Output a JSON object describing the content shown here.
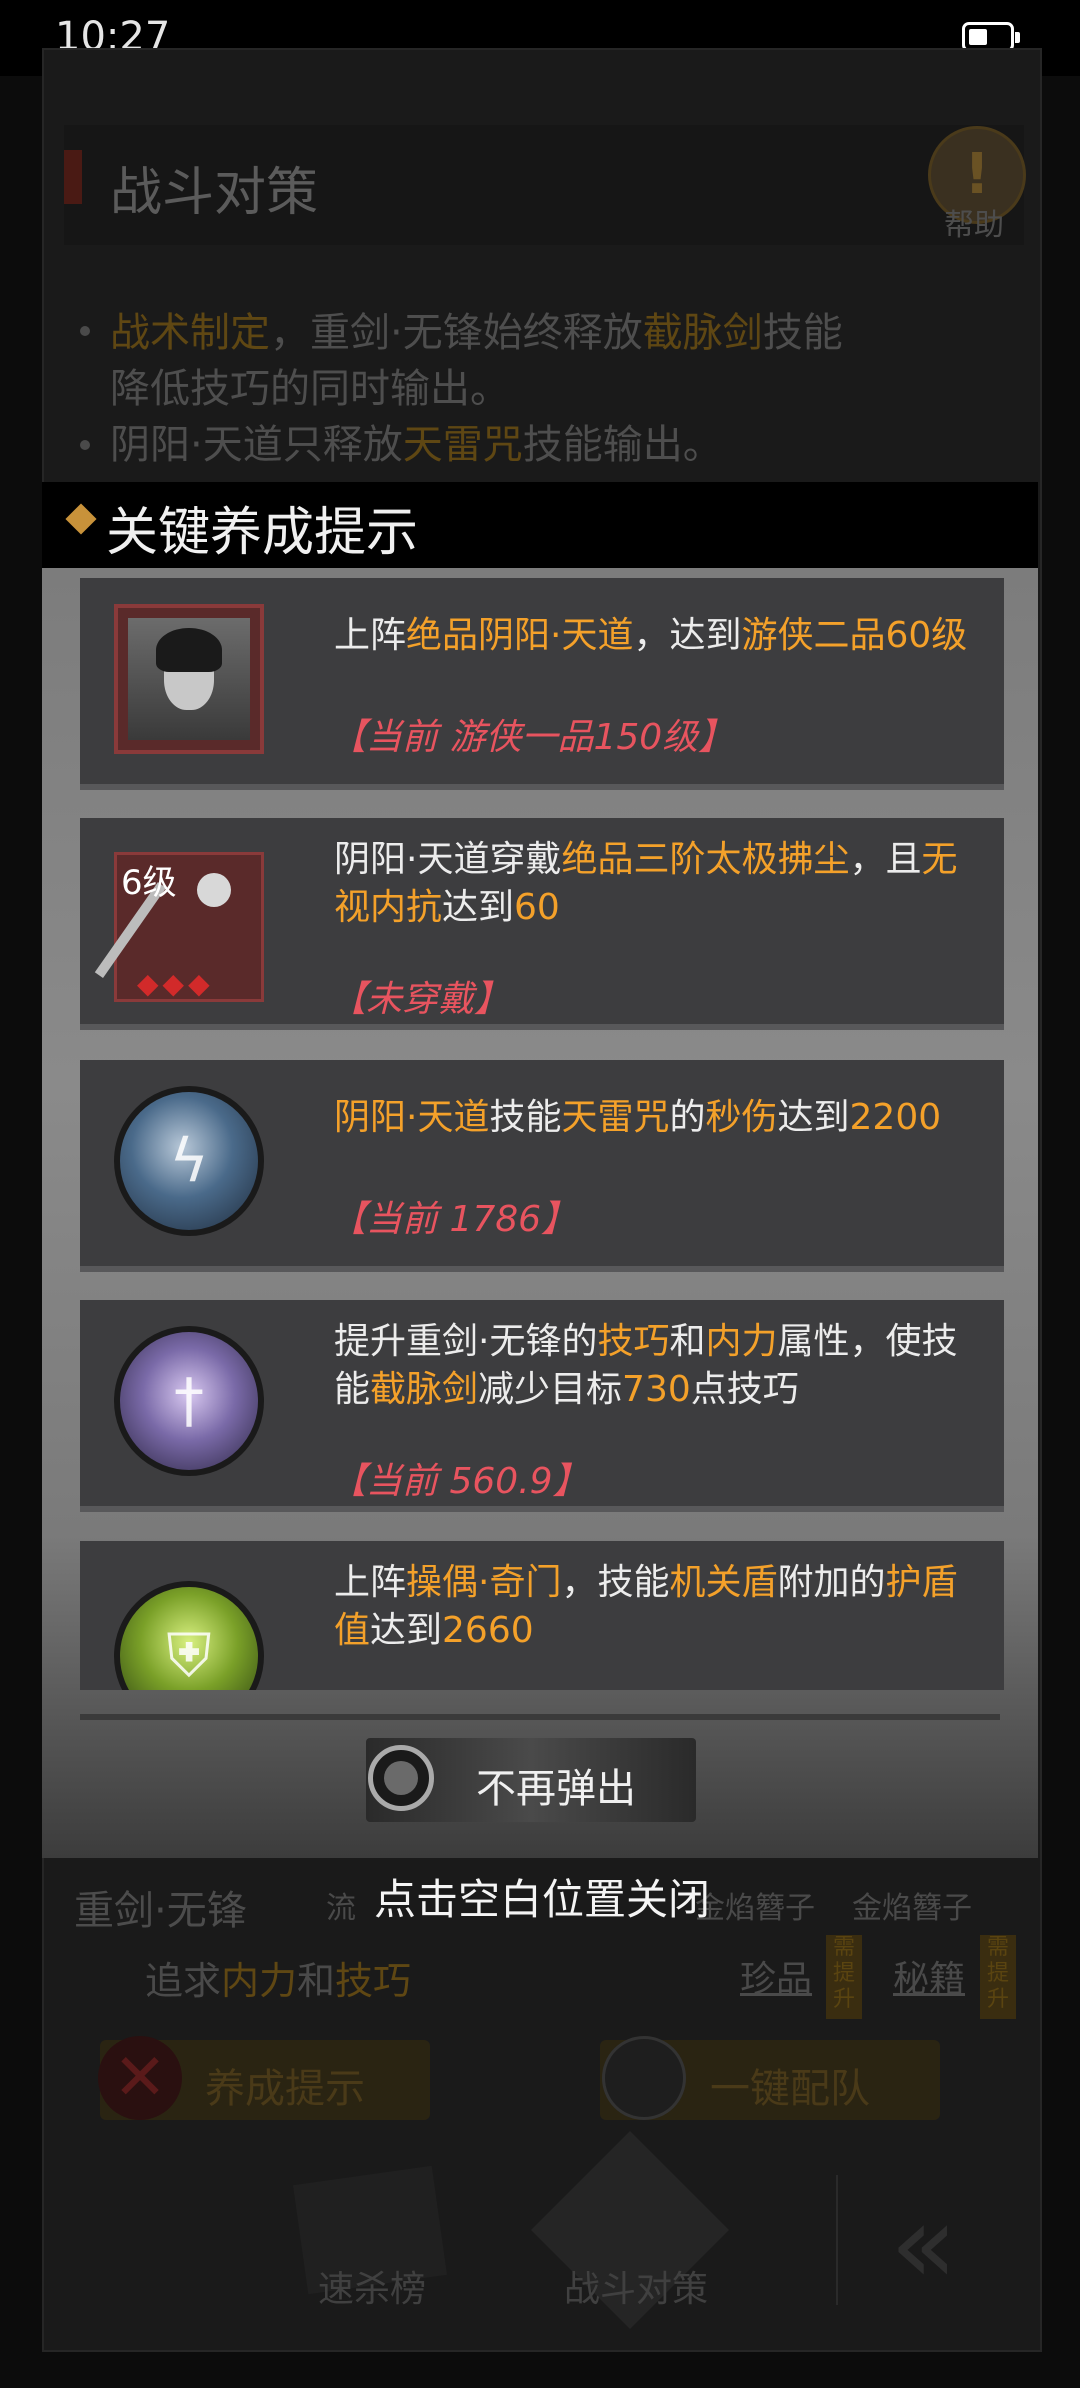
{
  "status_bar": {
    "time": "10:27",
    "battery_icon": "battery-icon"
  },
  "background": {
    "title": "战斗对策",
    "help_label": "帮助",
    "tips": [
      {
        "parts": [
          {
            "t": "战术制定",
            "hl": true
          },
          {
            "t": "，重剑·无锋始终释放",
            "hl": false
          },
          {
            "t": "截脉剑",
            "hl": true
          },
          {
            "t": "技能",
            "hl": false
          }
        ]
      },
      {
        "parts": [
          {
            "t": "降低技巧的同时输出。",
            "hl": false
          }
        ]
      },
      {
        "parts": [
          {
            "t": "阴阳·天道只释放",
            "hl": false
          },
          {
            "t": "天雷咒",
            "hl": true
          },
          {
            "t": "技能输出。",
            "hl": false
          }
        ]
      }
    ],
    "member_name": "重剑·无锋",
    "slot_left": "流",
    "slot_mid": "金焰簪子",
    "slot_right": "金焰簪子",
    "attr_parts": [
      {
        "t": "追求",
        "hl": false
      },
      {
        "t": "内力",
        "hl": true
      },
      {
        "t": "和",
        "hl": false
      },
      {
        "t": "技巧",
        "hl": true
      }
    ],
    "gem_links": [
      "珍品",
      "秘籍"
    ],
    "gem_tag": "需提升",
    "btn_tips": "养成提示",
    "btn_auto": "一键配队",
    "tab1": "速杀榜",
    "tab2": "战斗对策"
  },
  "modal": {
    "title": "关键养成提示",
    "cards": [
      {
        "icon": "character-portrait-icon",
        "text_parts": [
          {
            "t": "上阵",
            "hl": false
          },
          {
            "t": "绝品阴阳·天道",
            "hl": true
          },
          {
            "t": "，达到",
            "hl": false
          },
          {
            "t": "游侠二品60级",
            "hl": true
          }
        ],
        "status": "【当前 游侠一品150级】"
      },
      {
        "icon": "whisk-weapon-icon",
        "level_badge": "6级",
        "text_parts": [
          {
            "t": "阴阳·天道穿戴",
            "hl": false
          },
          {
            "t": "绝品三阶太极拂尘",
            "hl": true
          },
          {
            "t": "，且",
            "hl": false
          },
          {
            "t": "无视内抗",
            "hl": true
          },
          {
            "t": "达到",
            "hl": false
          },
          {
            "t": "60",
            "hl": true
          }
        ],
        "status": "【未穿戴】"
      },
      {
        "icon": "thunder-skill-icon",
        "text_parts": [
          {
            "t": "阴阳·天道",
            "hl": true
          },
          {
            "t": "技能",
            "hl": false
          },
          {
            "t": "天雷咒",
            "hl": true
          },
          {
            "t": "的",
            "hl": false
          },
          {
            "t": "秒伤",
            "hl": true
          },
          {
            "t": "达到",
            "hl": false
          },
          {
            "t": "2200",
            "hl": true
          }
        ],
        "status": "【当前 1786】"
      },
      {
        "icon": "sword-skill-icon",
        "text_parts": [
          {
            "t": "提升重剑·无锋的",
            "hl": false
          },
          {
            "t": "技巧",
            "hl": true
          },
          {
            "t": "和",
            "hl": false
          },
          {
            "t": "内力",
            "hl": true
          },
          {
            "t": "属性，使技能",
            "hl": false
          },
          {
            "t": "截脉剑",
            "hl": true
          },
          {
            "t": "减少目标",
            "hl": false
          },
          {
            "t": "730",
            "hl": true
          },
          {
            "t": "点技巧",
            "hl": false
          }
        ],
        "status": "【当前 560.9】"
      },
      {
        "icon": "shield-skill-icon",
        "text_parts": [
          {
            "t": "上阵",
            "hl": false
          },
          {
            "t": "操偶·奇门",
            "hl": true
          },
          {
            "t": "，技能",
            "hl": false
          },
          {
            "t": "机关盾",
            "hl": true
          },
          {
            "t": "附加的",
            "hl": false
          },
          {
            "t": "护盾值",
            "hl": true
          },
          {
            "t": "达到",
            "hl": false
          },
          {
            "t": "2660",
            "hl": true
          }
        ],
        "status": ""
      }
    ],
    "dont_show_label": "不再弹出",
    "close_hint": "点击空白位置关闭"
  },
  "colors": {
    "highlight": "#f4a12a",
    "status_red": "#e8545f",
    "accent_diamond": "#c8923a"
  }
}
